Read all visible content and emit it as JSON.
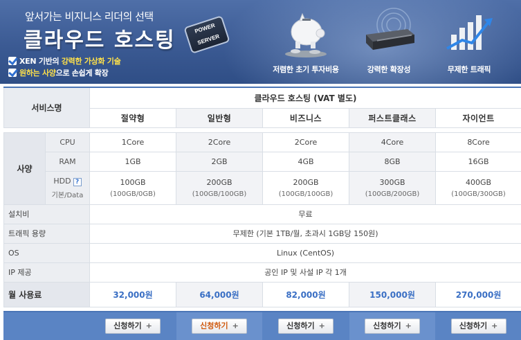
{
  "banner": {
    "title_small": "앞서가는 비지니스 리더의 선택",
    "title_big": "클라우드 호스팅",
    "badge_line1": "POWER",
    "badge_line2": "SERVER",
    "bullet1_pre": "XEN 기반의 ",
    "bullet1_hl": "강력한 가상화 기술",
    "bullet2_hl": "원하는 사양",
    "bullet2_post": "으로 손쉽게 확장",
    "features": [
      {
        "label": "저렴한 초기 투자비용",
        "icon": "piggy-bank-icon"
      },
      {
        "label": "강력한 확장성",
        "icon": "server-icon"
      },
      {
        "label": "무제한 트래픽",
        "icon": "bar-graph-icon"
      }
    ]
  },
  "table": {
    "service_header": "서비스명",
    "group_header": "클라우드 호스팅 (VAT 별도)",
    "plans": [
      "절약형",
      "일반형",
      "비즈니스",
      "퍼스트클래스",
      "자이언트"
    ],
    "spec_label": "사양",
    "cpu_label": "CPU",
    "ram_label": "RAM",
    "hdd_label": "HDD",
    "hdd_help": "?",
    "hdd_sub": "기본/Data",
    "cpu": [
      "1Core",
      "2Core",
      "2Core",
      "4Core",
      "8Core"
    ],
    "ram": [
      "1GB",
      "2GB",
      "4GB",
      "8GB",
      "16GB"
    ],
    "hdd": [
      "100GB",
      "200GB",
      "200GB",
      "300GB",
      "400GB"
    ],
    "hdd_detail": [
      "(100GB/0GB)",
      "(100GB/100GB)",
      "(100GB/100GB)",
      "(100GB/200GB)",
      "(100GB/300GB)"
    ],
    "setup_label": "설치비",
    "setup_value": "무료",
    "traffic_label": "트래픽 용량",
    "traffic_value": "무제한 (기본 1TB/월, 초과시 1GB당 150원)",
    "os_label": "OS",
    "os_value": "Linux (CentOS)",
    "ip_label": "IP 제공",
    "ip_value": "공인 IP 및 사설 IP 각 1개",
    "price_label": "월 사용료",
    "prices": [
      "32,000원",
      "64,000원",
      "82,000원",
      "150,000원",
      "270,000원"
    ],
    "apply_label": "신청하기",
    "apply_plus": "+"
  }
}
